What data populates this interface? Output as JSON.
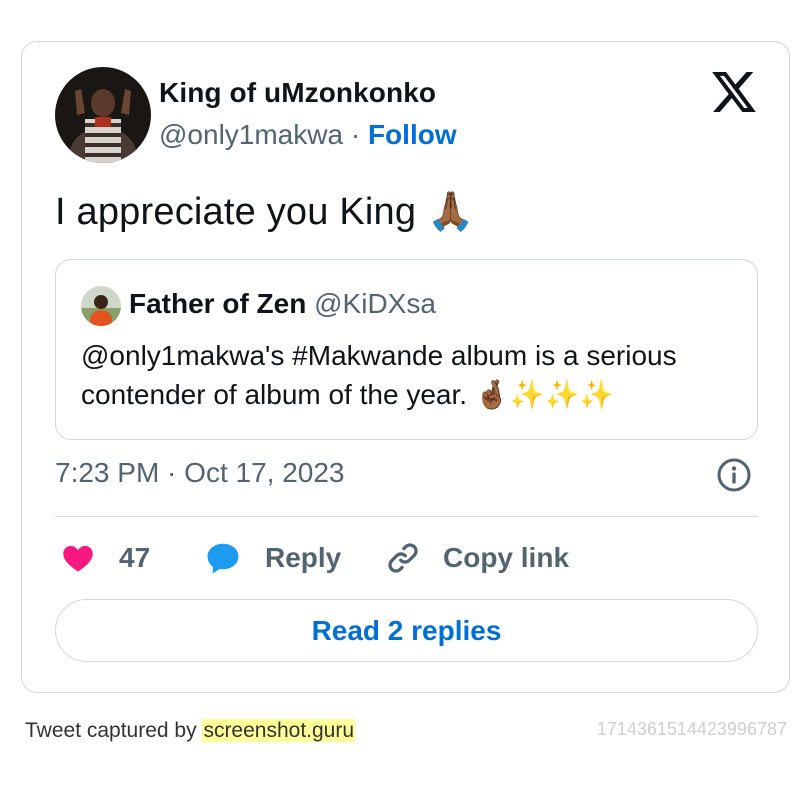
{
  "author": {
    "display_name": "King of uMzonkonko",
    "handle": "@only1makwa",
    "separator": " · ",
    "follow_label": "Follow"
  },
  "brand_icon": "x-logo-icon",
  "tweet": {
    "text": "I appreciate you King ",
    "emoji": "🙏🏾"
  },
  "quoted_tweet": {
    "display_name": "Father of Zen",
    "handle": "@KiDXsa",
    "text": "@only1makwa's #Makwande album is a serious contender of album of the year. ",
    "emoji": "🤞🏾✨✨✨"
  },
  "timestamp": "7:23 PM · Oct 17, 2023",
  "actions": {
    "like_count": "47",
    "reply_label": "Reply",
    "copy_label": "Copy link"
  },
  "read_replies_label": "Read 2 replies",
  "footer": {
    "captured_prefix": "Tweet captured by ",
    "captured_brand": "screenshot.guru",
    "tweet_id": "1714361514423996787"
  },
  "colors": {
    "accent": "#006fd6",
    "like": "#f91880",
    "reply": "#1d9bf0",
    "muted": "#536471",
    "border": "#cfd9de"
  }
}
